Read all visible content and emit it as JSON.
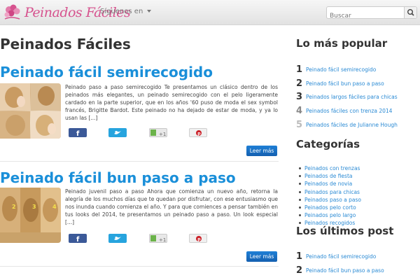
{
  "header": {
    "logo_text": "Peinados Fáciles",
    "follow_label": "Síguenos en",
    "search_placeholder": "Buscar"
  },
  "main": {
    "page_title": "Peinados Fáciles",
    "posts": [
      {
        "title": "Peinado fácil semirecogido",
        "excerpt": "Peinado paso a paso semirecogido Te presentamos un clásico dentro de los peinados más elegantes, un peinado semirecogido con el pelo ligeramente cardado en la parte superior, que en los años '60 puso de moda el sex symbol francés, Brigitte Bardot. Este peinado no ha dejado de estar de moda, y ya lo usan las [...]",
        "read_more": "Leer más"
      },
      {
        "title": "Peinado fácil bun paso a paso",
        "excerpt": "Peinado juvenil paso a paso Ahora que comienza un nuevo año, retorna la alegría de los muchos días que te quedan por disfrutar, con ese entusiasmo que nos inunda cuando comienza el año. Y para que comiences a pensar también en tus looks del 2014, te presentamos un peinado paso a paso. Un look especial [...]",
        "thumb_steps": [
          "2",
          "3",
          "4"
        ],
        "read_more": "Leer más"
      }
    ],
    "share_labels": {
      "gplus_count": "+1"
    }
  },
  "sidebar": {
    "popular_heading": "Lo más popular",
    "popular": [
      {
        "num": "1",
        "label": "Peinado fácil semirecogido"
      },
      {
        "num": "2",
        "label": "Peinado fácil bun paso a paso"
      },
      {
        "num": "3",
        "label": "Peinados largos fáciles para chicas"
      },
      {
        "num": "4",
        "label": "Peinados fáciles con trenza 2014"
      },
      {
        "num": "5",
        "label": "Peinados fáciles de Julianne Hough"
      }
    ],
    "categories_heading": "Categorías",
    "categories": [
      "Peinados con trenzas",
      "Peinados de fiesta",
      "Peinados de novia",
      "Peinados para chicas",
      "Peinados paso a paso",
      "Peinados pelo corto",
      "Peinados pelo largo",
      "Peinados recogidos"
    ],
    "latest_heading": "Los últimos post",
    "latest": [
      {
        "num": "1",
        "label": "Peinado fácil semirecogido"
      },
      {
        "num": "2",
        "label": "Peinado fácil bun paso a paso"
      }
    ]
  },
  "colors": {
    "brand_pink": "#d6528e",
    "link_blue": "#1a8fd9",
    "button_blue": "#1460b0",
    "facebook": "#3b5998",
    "twitter": "#27a4de"
  }
}
